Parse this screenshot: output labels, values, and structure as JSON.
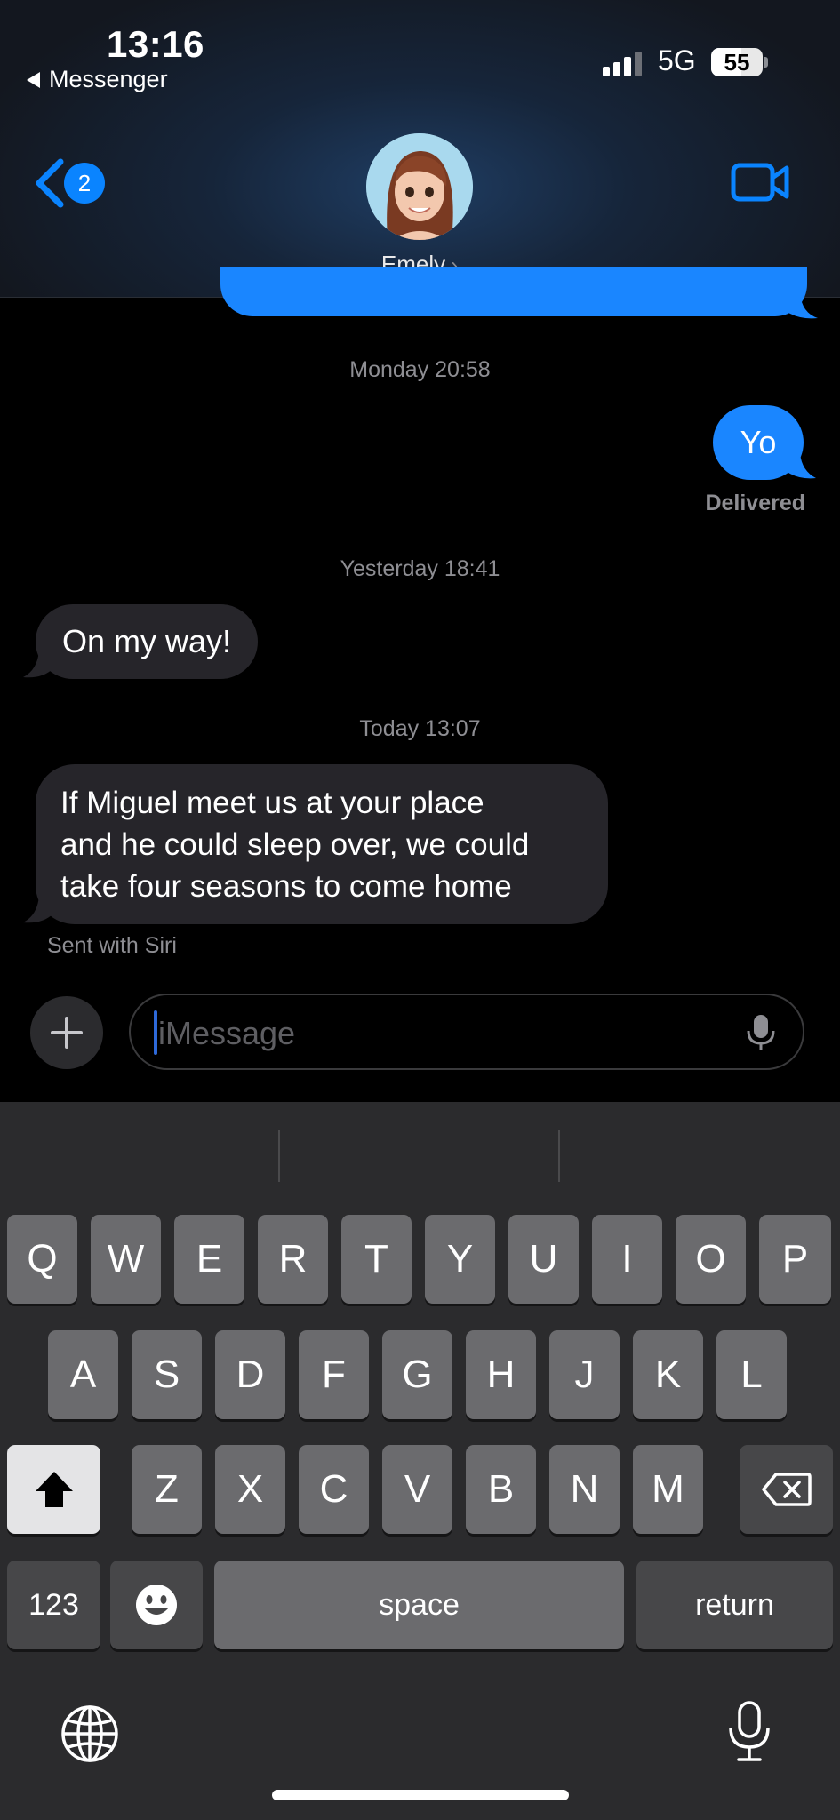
{
  "status_bar": {
    "time": "13:16",
    "back_app": "Messenger",
    "network": "5G",
    "battery": "55",
    "battery_level": 0.55
  },
  "header": {
    "unread_count": "2",
    "contact_name": "Emely",
    "contact_chevron": "›"
  },
  "conversation": {
    "timestamp_1": "Monday 20:58",
    "msg_yo": "Yo",
    "delivered": "Delivered",
    "timestamp_2": "Yesterday 18:41",
    "msg_on_my_way": "On my way!",
    "timestamp_3": "Today 13:07",
    "msg_long_lines": [
      "If Miguel meet us at your place",
      "and he could sleep over, we could",
      "take four seasons to come home"
    ],
    "sent_with": "Sent with Siri"
  },
  "composer": {
    "placeholder": "iMessage"
  },
  "keyboard": {
    "row1": [
      "Q",
      "W",
      "E",
      "R",
      "T",
      "Y",
      "U",
      "I",
      "O",
      "P"
    ],
    "row2": [
      "A",
      "S",
      "D",
      "F",
      "G",
      "H",
      "J",
      "K",
      "L"
    ],
    "row3": [
      "Z",
      "X",
      "C",
      "V",
      "B",
      "N",
      "M"
    ],
    "numbers": "123",
    "space": "space",
    "return": "return"
  },
  "colors": {
    "accent": "#0a84ff",
    "outgoing_bubble": "#1a86ff",
    "incoming_bubble": "#26252a",
    "keyboard_bg": "#2b2b2d"
  },
  "icons": [
    "back-chevron-icon",
    "video-camera-icon",
    "plus-icon",
    "microphone-icon",
    "shift-icon",
    "backspace-icon",
    "emoji-icon",
    "globe-icon",
    "dictation-icon"
  ]
}
